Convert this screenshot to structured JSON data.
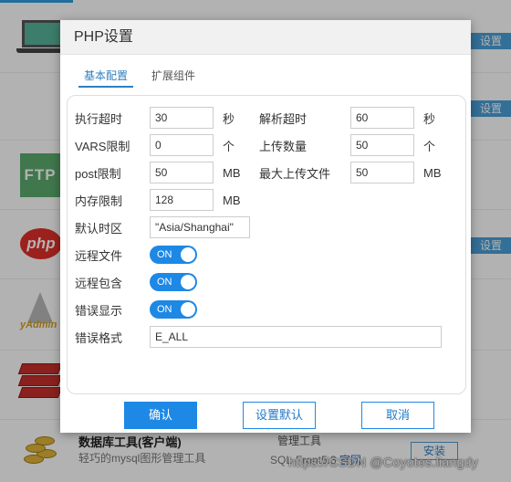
{
  "background": {
    "settings_label": "设置",
    "db_tool": {
      "title": "数据库工具(客户端)",
      "description": "轻巧的mysql图形管理工具",
      "type": "管理工具",
      "author_prefix": "SQL-Front5.3",
      "author_link": "官网",
      "install_label": "安装"
    },
    "watermark": "https://CSDN @Coyotes.liangdy",
    "icons": {
      "ftp_text": "FTP",
      "php_text": "php",
      "yadmin_text": "yAdmin"
    }
  },
  "dialog": {
    "title": "PHP设置",
    "tabs": [
      {
        "label": "基本配置",
        "active": true
      },
      {
        "label": "扩展组件",
        "active": false
      }
    ],
    "fields": {
      "exec_timeout": {
        "label": "执行超时",
        "value": "30",
        "unit": "秒"
      },
      "parse_timeout": {
        "label": "解析超时",
        "value": "60",
        "unit": "秒"
      },
      "vars_limit": {
        "label": "VARS限制",
        "value": "0",
        "unit": "个"
      },
      "upload_count": {
        "label": "上传数量",
        "value": "50",
        "unit": "个"
      },
      "post_limit": {
        "label": "post限制",
        "value": "50",
        "unit": "MB"
      },
      "max_upload": {
        "label": "最大上传文件",
        "value": "50",
        "unit": "MB"
      },
      "memory_limit": {
        "label": "内存限制",
        "value": "128",
        "unit": "MB"
      },
      "timezone": {
        "label": "默认时区",
        "value": "\"Asia/Shanghai\""
      },
      "remote_file": {
        "label": "远程文件",
        "state": "ON"
      },
      "remote_include": {
        "label": "远程包含",
        "state": "ON"
      },
      "error_display": {
        "label": "错误显示",
        "state": "ON"
      },
      "error_format": {
        "label": "错误格式",
        "value": "E_ALL"
      }
    },
    "buttons": {
      "ok": "确认",
      "set_default": "设置默认",
      "cancel": "取消"
    }
  },
  "colors": {
    "accent": "#1e88e5",
    "header_bg": "#f1f1f1"
  }
}
